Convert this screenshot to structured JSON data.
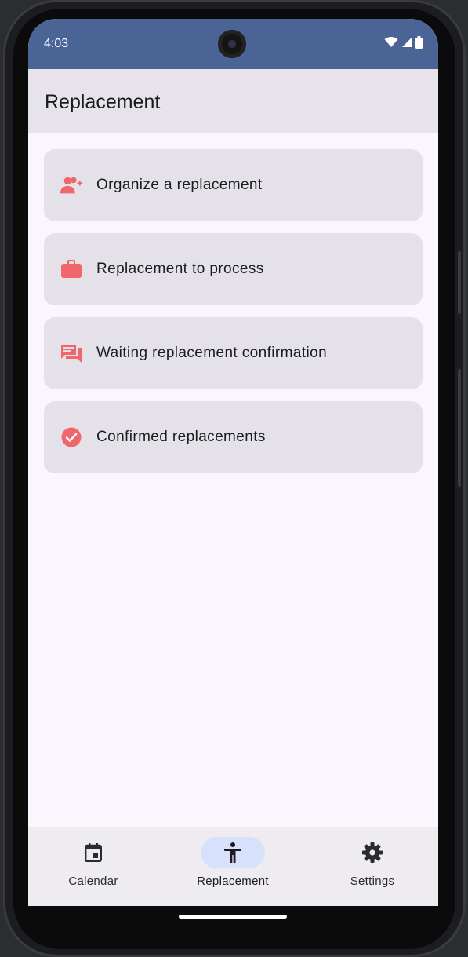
{
  "status_bar": {
    "time": "4:03",
    "icons": [
      "wifi-icon",
      "cell-signal-icon",
      "battery-icon"
    ]
  },
  "top_bar": {
    "title": "Replacement"
  },
  "menu": {
    "items": [
      {
        "label": "Organize a replacement",
        "icon": "person-add-icon"
      },
      {
        "label": "Replacement to process",
        "icon": "briefcase-icon"
      },
      {
        "label": "Waiting replacement confirmation",
        "icon": "chat-bubble-icon"
      },
      {
        "label": "Confirmed replacements",
        "icon": "check-circle-icon"
      }
    ]
  },
  "bottom_nav": {
    "items": [
      {
        "label": "Calendar",
        "icon": "calendar-icon",
        "active": false
      },
      {
        "label": "Replacement",
        "icon": "accessibility-icon",
        "active": true
      },
      {
        "label": "Settings",
        "icon": "gear-icon",
        "active": false
      }
    ]
  },
  "colors": {
    "status_bar": "#4a6496",
    "accent_icon": "#f0676b",
    "card": "#e4e2e8",
    "active_pill": "#d8e1fb"
  }
}
